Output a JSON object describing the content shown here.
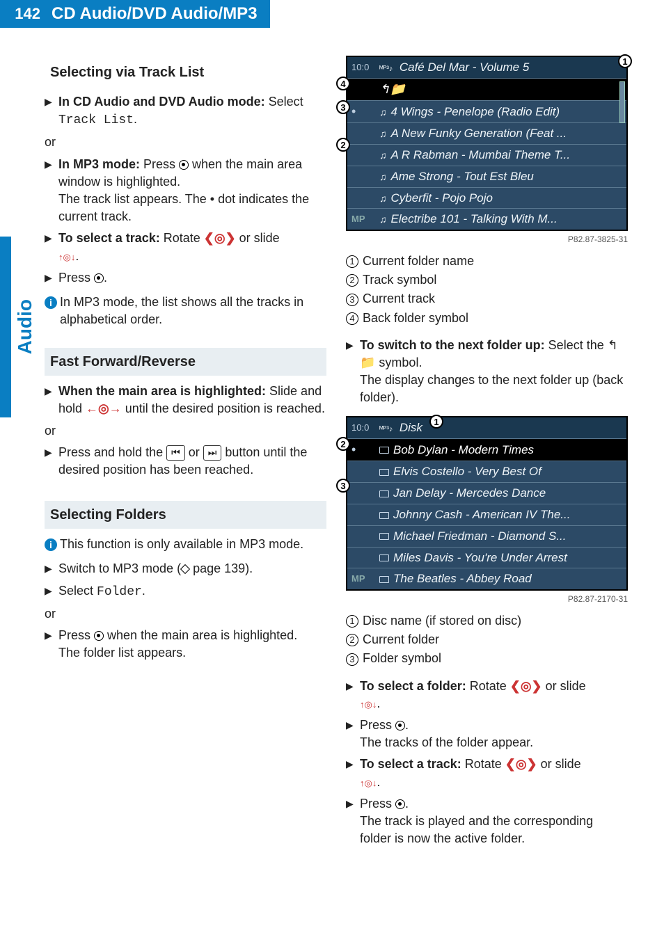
{
  "page_number": "142",
  "header_title": "CD Audio/DVD Audio/MP3",
  "side_tab": "Audio",
  "left": {
    "h_tracklist": "Selecting via Track List",
    "step1_bold": "In CD Audio and DVD Audio mode:",
    "step1_rest": " Select ",
    "step1_mono": "Track List",
    "step1_dot": ".",
    "or": "or",
    "step2_bold": "In MP3 mode:",
    "step2_rest_a": " Press ",
    "step2_rest_b": " when the main area window is highlighted.",
    "step2_line2": "The track list appears. The  •  dot indicates the current track.",
    "step3_bold": "To select a track:",
    "step3_rest_a": " Rotate ",
    "step3_rest_b": " or slide ",
    "step3_rest_c": ".",
    "step4": "Press ",
    "step4b": ".",
    "info1": "In MP3 mode, the list shows all the tracks in alphabetical order.",
    "h_ffrev": "Fast Forward/Reverse",
    "ff_step1_bold": "When the main area is highlighted:",
    "ff_step1_rest_a": " Slide and hold ",
    "ff_step1_rest_b": " until the desired position is reached.",
    "ff_or": "or",
    "ff_step2_a": "Press and hold the ",
    "ff_step2_b": " or ",
    "ff_step2_c": " button until the desired position has been reached.",
    "key_prev": "⏮",
    "key_next": "⏭",
    "h_folders": "Selecting Folders",
    "info2": "This function is only available in MP3 mode.",
    "fold_step1_a": "Switch to MP3 mode (",
    "fold_step1_b": " page 139).",
    "fold_step2_a": "Select ",
    "fold_step2_mono": "Folder",
    "fold_step2_b": ".",
    "fold_or": "or",
    "fold_step3_a": "Press ",
    "fold_step3_b": " when the main area is highlighted.",
    "fold_step3_line2": "The folder list appears."
  },
  "right": {
    "fig1": {
      "time": "10:0",
      "header": "Café Del Mar - Volume 5",
      "rows": [
        "4 Wings - Penelope (Radio Edit)",
        "A New Funky Generation (Feat ...",
        "A R Rabman - Mumbai Theme T...",
        "Ame Strong - Tout Est Bleu",
        "Cyberfit - Pojo Pojo",
        "Electribe 101 - Talking With M..."
      ],
      "mp": "MP",
      "credit": "P82.87-3825-31"
    },
    "legend1": {
      "l1": "Current folder name",
      "l2": "Track symbol",
      "l3": "Current track",
      "l4": "Back folder symbol"
    },
    "switch_bold": "To switch to the next folder up:",
    "switch_rest_a": " Select the  ",
    "switch_rest_b": "  symbol.",
    "switch_line2": "The display changes to the next folder up (back folder).",
    "fig2": {
      "time": "10:0",
      "header": "Disk",
      "rows": [
        "Bob Dylan - Modern Times",
        "Elvis Costello - Very Best Of",
        "Jan Delay - Mercedes Dance",
        "Johnny Cash - American IV The...",
        "Michael Friedman - Diamond S...",
        "Miles Davis - You're Under Arrest",
        "The Beatles - Abbey Road"
      ],
      "mp": "MP",
      "credit": "P82.87-2170-31"
    },
    "legend2": {
      "l1": "Disc name (if stored on disc)",
      "l2": "Current folder",
      "l3": "Folder symbol"
    },
    "sel_folder_bold": "To select a folder:",
    "sel_folder_rest_a": " Rotate ",
    "sel_folder_rest_b": " or slide ",
    "sel_folder_rest_c": ".",
    "press_a": "Press ",
    "press_b": ".",
    "tracks_appear": "The tracks of the folder appear.",
    "sel_track_bold": "To select a track:",
    "sel_track_rest_a": " Rotate ",
    "sel_track_rest_b": " or slide ",
    "sel_track_rest_c": ".",
    "final_line": "The track is played and the corresponding folder is now the active folder."
  }
}
